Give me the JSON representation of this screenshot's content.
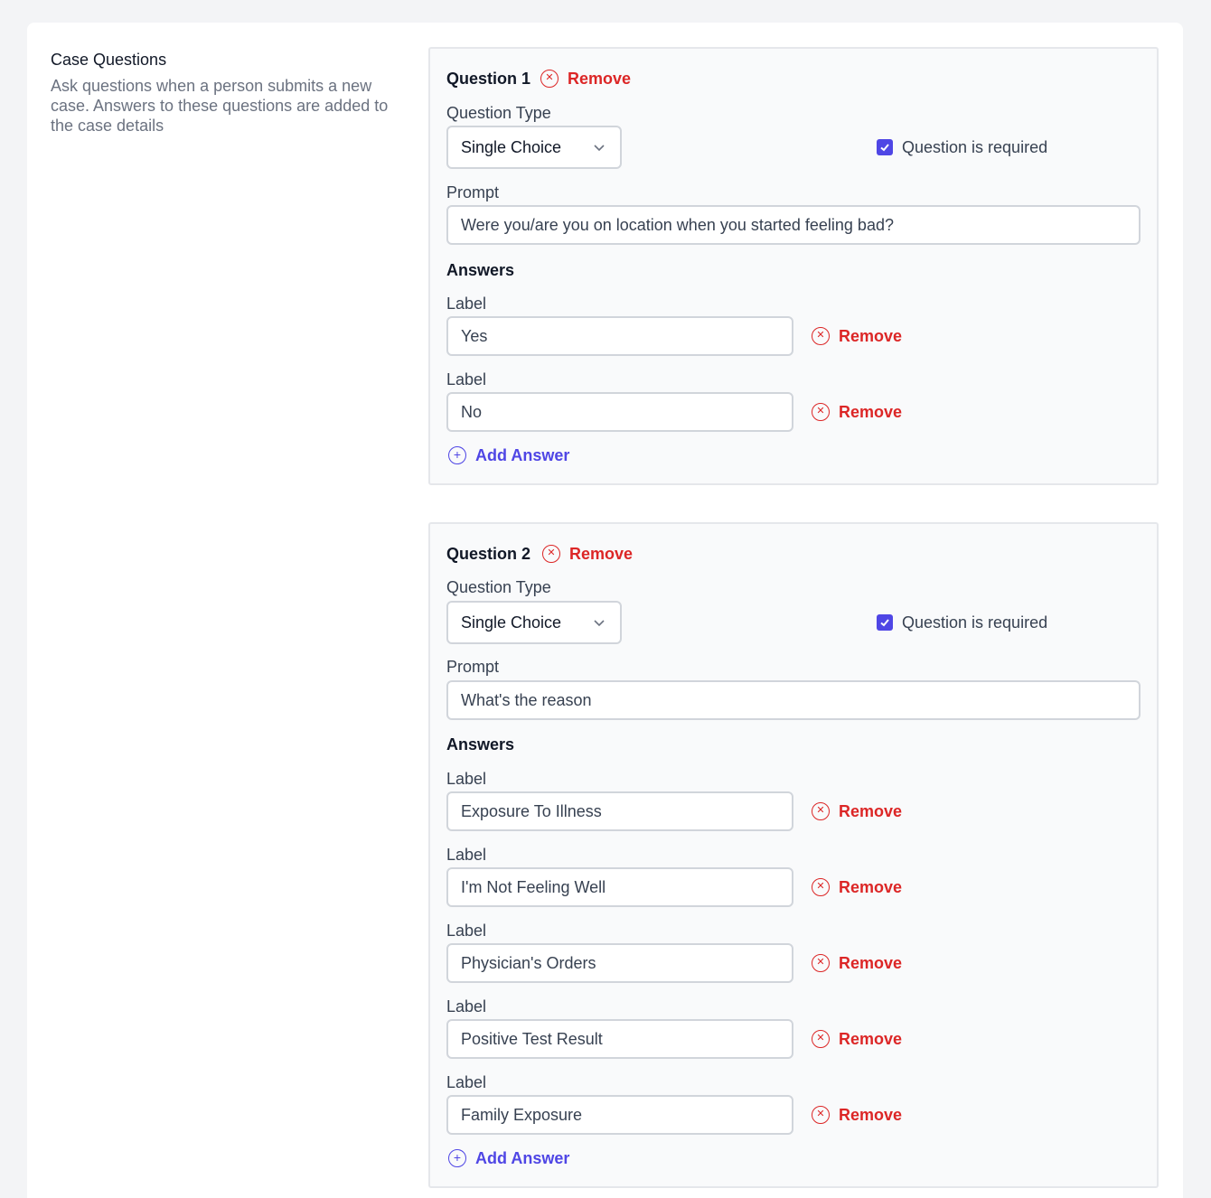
{
  "section": {
    "title": "Case Questions",
    "description": "Ask questions when a person submits a new case. Answers to these questions are added to the case details"
  },
  "labels": {
    "remove": "Remove",
    "question_type": "Question Type",
    "required": "Question is required",
    "prompt": "Prompt",
    "answers": "Answers",
    "label": "Label",
    "add_answer": "Add Answer"
  },
  "questions": [
    {
      "title": "Question 1",
      "type": "Single Choice",
      "required": true,
      "prompt": "Were you/are you on location when you started feeling bad?",
      "answers": [
        "Yes",
        "No"
      ]
    },
    {
      "title": "Question 2",
      "type": "Single Choice",
      "required": true,
      "prompt": "What's the reason",
      "answers": [
        "Exposure To Illness",
        "I'm Not Feeling Well",
        "Physician's Orders",
        "Positive Test Result",
        "Family Exposure"
      ]
    }
  ],
  "colors": {
    "danger": "#dc2626",
    "accent": "#4f46e5"
  }
}
